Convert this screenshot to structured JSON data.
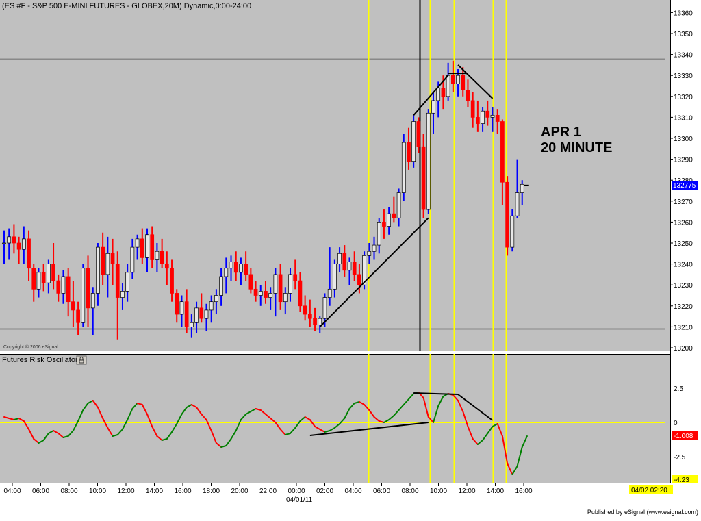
{
  "window": {
    "title": "(ES #F - S&P 500 E-MINI FUTURES - GLOBEX,20M) Dynamic,0:00-24:00",
    "copyright": "Copyright © 2006 eSignal.",
    "published_by": "Published by eSignal (www.esignal.com)"
  },
  "annotation": {
    "line1": "APR 1",
    "line2": "20 MINUTE"
  },
  "colors": {
    "panel_bg": "#c0c0c0",
    "axis_bg": "#ffffff",
    "up_candle": "#0000ff",
    "down_candle": "#ff0000",
    "neutral_candle": "#e8e8e8",
    "oscillator_up": "#008000",
    "oscillator_down": "#ff0000",
    "vertical_marker": "#ffff00",
    "reference_line": "#888888",
    "trendline": "#000000",
    "price_tag_bg": "#0000ff",
    "osc_tag_bg": "#ff0000",
    "time_tag_bg": "#ffff00"
  },
  "price_axis": {
    "min": 13200,
    "max": 13360,
    "ticks": [
      "13360",
      "13350",
      "13340",
      "13330",
      "13320",
      "13310",
      "13300",
      "13290",
      "13280",
      "13270",
      "13260",
      "13250",
      "13240",
      "13230",
      "13220",
      "13210",
      "13200"
    ],
    "last_value": "132775"
  },
  "time_axis": {
    "ticks": [
      "04:00",
      "06:00",
      "08:00",
      "10:00",
      "12:00",
      "14:00",
      "16:00",
      "18:00",
      "20:00",
      "22:00",
      "00:00",
      "02:00",
      "04:00",
      "06:00",
      "08:00",
      "10:00",
      "12:00",
      "14:00",
      "16:00"
    ],
    "date_label": "04/01/11",
    "current_time": "04/02 02:20"
  },
  "oscillator": {
    "title": "Futures Risk Oscillator",
    "ticks": [
      "2.5",
      "0",
      "-2.5"
    ],
    "last_value": "-1.008",
    "min_value": "-4.23",
    "range": [
      -4.6,
      3.0
    ]
  },
  "chart_data": [
    {
      "type": "candlestick",
      "title": "(ES #F - S&P 500 E-MINI FUTURES - GLOBEX,20M) Dynamic,0:00-24:00",
      "xlabel": "",
      "ylabel": "",
      "ylim": [
        13200,
        13360
      ],
      "x_ticks": [
        "04:00",
        "06:00",
        "08:00",
        "10:00",
        "12:00",
        "14:00",
        "16:00",
        "18:00",
        "20:00",
        "22:00",
        "00:00",
        "02:00",
        "04:00",
        "06:00",
        "08:00",
        "10:00",
        "12:00",
        "14:00",
        "16:00"
      ],
      "reference_levels": [
        13338,
        13209
      ],
      "last_close": 13277.5,
      "ohlc": [
        [
          13250,
          13256,
          13240,
          13250
        ],
        [
          13250,
          13257,
          13242,
          13253
        ],
        [
          13253,
          13259,
          13245,
          13250
        ],
        [
          13250,
          13253,
          13240,
          13247
        ],
        [
          13247,
          13258,
          13240,
          13252
        ],
        [
          13252,
          13256,
          13232,
          13238
        ],
        [
          13238,
          13240,
          13222,
          13228
        ],
        [
          13228,
          13238,
          13224,
          13236
        ],
        [
          13236,
          13240,
          13227,
          13231
        ],
        [
          13231,
          13242,
          13226,
          13240
        ],
        [
          13240,
          13250,
          13228,
          13232
        ],
        [
          13232,
          13235,
          13222,
          13226
        ],
        [
          13226,
          13237,
          13221,
          13234
        ],
        [
          13234,
          13238,
          13215,
          13222
        ],
        [
          13222,
          13232,
          13210,
          13218
        ],
        [
          13218,
          13222,
          13206,
          13212
        ],
        [
          13212,
          13240,
          13210,
          13238
        ],
        [
          13238,
          13244,
          13210,
          13219
        ],
        [
          13219,
          13229,
          13206,
          13226
        ],
        [
          13226,
          13250,
          13220,
          13248
        ],
        [
          13248,
          13255,
          13230,
          13235
        ],
        [
          13235,
          13253,
          13224,
          13245
        ],
        [
          13245,
          13252,
          13230,
          13240
        ],
        [
          13240,
          13246,
          13204,
          13224
        ],
        [
          13224,
          13231,
          13218,
          13227
        ],
        [
          13227,
          13240,
          13222,
          13236
        ],
        [
          13236,
          13252,
          13233,
          13248
        ],
        [
          13248,
          13254,
          13242,
          13252
        ],
        [
          13252,
          13257,
          13240,
          13243
        ],
        [
          13243,
          13257,
          13236,
          13254
        ],
        [
          13254,
          13258,
          13238,
          13242
        ],
        [
          13242,
          13250,
          13236,
          13246
        ],
        [
          13246,
          13252,
          13238,
          13240
        ],
        [
          13240,
          13246,
          13230,
          13238
        ],
        [
          13238,
          13242,
          13222,
          13226
        ],
        [
          13226,
          13228,
          13212,
          13216
        ],
        [
          13216,
          13225,
          13210,
          13222
        ],
        [
          13222,
          13228,
          13207,
          13210
        ],
        [
          13210,
          13216,
          13205,
          13212
        ],
        [
          13212,
          13222,
          13207,
          13219
        ],
        [
          13219,
          13226,
          13212,
          13214
        ],
        [
          13214,
          13221,
          13208,
          13218
        ],
        [
          13218,
          13225,
          13212,
          13222
        ],
        [
          13222,
          13228,
          13216,
          13225
        ],
        [
          13225,
          13238,
          13220,
          13234
        ],
        [
          13234,
          13243,
          13226,
          13238
        ],
        [
          13238,
          13244,
          13232,
          13241
        ],
        [
          13241,
          13246,
          13232,
          13236
        ],
        [
          13236,
          13243,
          13230,
          13240
        ],
        [
          13240,
          13246,
          13232,
          13235
        ],
        [
          13235,
          13238,
          13226,
          13228
        ],
        [
          13228,
          13232,
          13222,
          13225
        ],
        [
          13225,
          13230,
          13220,
          13227
        ],
        [
          13227,
          13232,
          13221,
          13224
        ],
        [
          13224,
          13229,
          13218,
          13226
        ],
        [
          13226,
          13238,
          13215,
          13235
        ],
        [
          13235,
          13240,
          13218,
          13222
        ],
        [
          13222,
          13229,
          13216,
          13226
        ],
        [
          13226,
          13238,
          13222,
          13235
        ],
        [
          13235,
          13242,
          13228,
          13232
        ],
        [
          13232,
          13236,
          13217,
          13220
        ],
        [
          13220,
          13225,
          13213,
          13216
        ],
        [
          13216,
          13223,
          13210,
          13214
        ],
        [
          13214,
          13219,
          13208,
          13211
        ],
        [
          13211,
          13215,
          13207,
          13214
        ],
        [
          13214,
          13226,
          13210,
          13224
        ],
        [
          13224,
          13248,
          13220,
          13228
        ],
        [
          13228,
          13242,
          13224,
          13240
        ],
        [
          13240,
          13248,
          13236,
          13245
        ],
        [
          13245,
          13249,
          13234,
          13237
        ],
        [
          13237,
          13243,
          13230,
          13241
        ],
        [
          13241,
          13246,
          13232,
          13235
        ],
        [
          13235,
          13240,
          13226,
          13230
        ],
        [
          13230,
          13246,
          13228,
          13244
        ],
        [
          13244,
          13250,
          13240,
          13246
        ],
        [
          13246,
          13253,
          13242,
          13249
        ],
        [
          13249,
          13262,
          13245,
          13260
        ],
        [
          13260,
          13266,
          13252,
          13258
        ],
        [
          13258,
          13267,
          13254,
          13264
        ],
        [
          13264,
          13272,
          13260,
          13262
        ],
        [
          13262,
          13276,
          13258,
          13274
        ],
        [
          13274,
          13302,
          13270,
          13298
        ],
        [
          13298,
          13305,
          13285,
          13289
        ],
        [
          13289,
          13311,
          13286,
          13308
        ],
        [
          13308,
          13310,
          13293,
          13296
        ],
        [
          13296,
          13302,
          13262,
          13266
        ],
        [
          13266,
          13314,
          13264,
          13312
        ],
        [
          13312,
          13322,
          13302,
          13318
        ],
        [
          13318,
          13327,
          13310,
          13324
        ],
        [
          13324,
          13330,
          13314,
          13320
        ],
        [
          13320,
          13336,
          13318,
          13330
        ],
        [
          13330,
          13337,
          13322,
          13326
        ],
        [
          13326,
          13333,
          13320,
          13330
        ],
        [
          13330,
          13334,
          13320,
          13323
        ],
        [
          13323,
          13328,
          13315,
          13318
        ],
        [
          13318,
          13322,
          13305,
          13310
        ],
        [
          13310,
          13318,
          13303,
          13307
        ],
        [
          13307,
          13315,
          13303,
          13313
        ],
        [
          13313,
          13318,
          13306,
          13310
        ],
        [
          13310,
          13315,
          13303,
          13311
        ],
        [
          13311,
          13314,
          13302,
          13308
        ],
        [
          13308,
          13309,
          13268,
          13279
        ],
        [
          13279,
          13282,
          13244,
          13248
        ],
        [
          13248,
          13266,
          13246,
          13263
        ],
        [
          13263,
          13290,
          13262,
          13274
        ],
        [
          13274,
          13280,
          13268,
          13278
        ]
      ]
    },
    {
      "type": "line",
      "title": "Futures Risk Oscillator",
      "y_ticks": [
        "2.5",
        "0",
        "-2.5"
      ],
      "ylim": [
        -4.6,
        3.0
      ],
      "last_value": -1.008,
      "series": [
        {
          "values": [
            0.4,
            0.3,
            0.2,
            0.3,
            0.1,
            -0.5,
            -1.2,
            -1.5,
            -1.3,
            -0.8,
            -0.6,
            -0.8,
            -1.1,
            -1.0,
            -0.6,
            0.1,
            0.9,
            1.4,
            1.6,
            1.1,
            0.3,
            -0.4,
            -1.0,
            -0.9,
            -0.5,
            0.2,
            1.0,
            1.4,
            1.3,
            0.6,
            -0.3,
            -1.0,
            -1.3,
            -1.2,
            -0.7,
            -0.1,
            0.6,
            1.1,
            1.3,
            1.1,
            0.6,
            0.2,
            -0.6,
            -1.5,
            -1.8,
            -1.7,
            -1.2,
            -0.6,
            0.2,
            0.6,
            0.8,
            1.0,
            0.9,
            0.6,
            0.3,
            0.0,
            -0.5,
            -0.9,
            -0.8,
            -0.4,
            0.1,
            0.4,
            0.2,
            -0.3,
            -0.5,
            -0.7,
            -0.6,
            -0.4,
            -0.1,
            0.3,
            1.0,
            1.4,
            1.5,
            1.3,
            0.9,
            0.4,
            0.1,
            0.0,
            0.2,
            0.5,
            0.9,
            1.3,
            1.7,
            2.1,
            2.2,
            1.8,
            0.4,
            0.0,
            1.2,
            1.9,
            2.1,
            2.0,
            1.6,
            0.8,
            -0.3,
            -1.2,
            -1.6,
            -1.3,
            -0.8,
            -0.3,
            -0.1,
            -1.0,
            -3.0,
            -3.8,
            -3.2,
            -1.8,
            -1.0
          ]
        }
      ]
    }
  ]
}
